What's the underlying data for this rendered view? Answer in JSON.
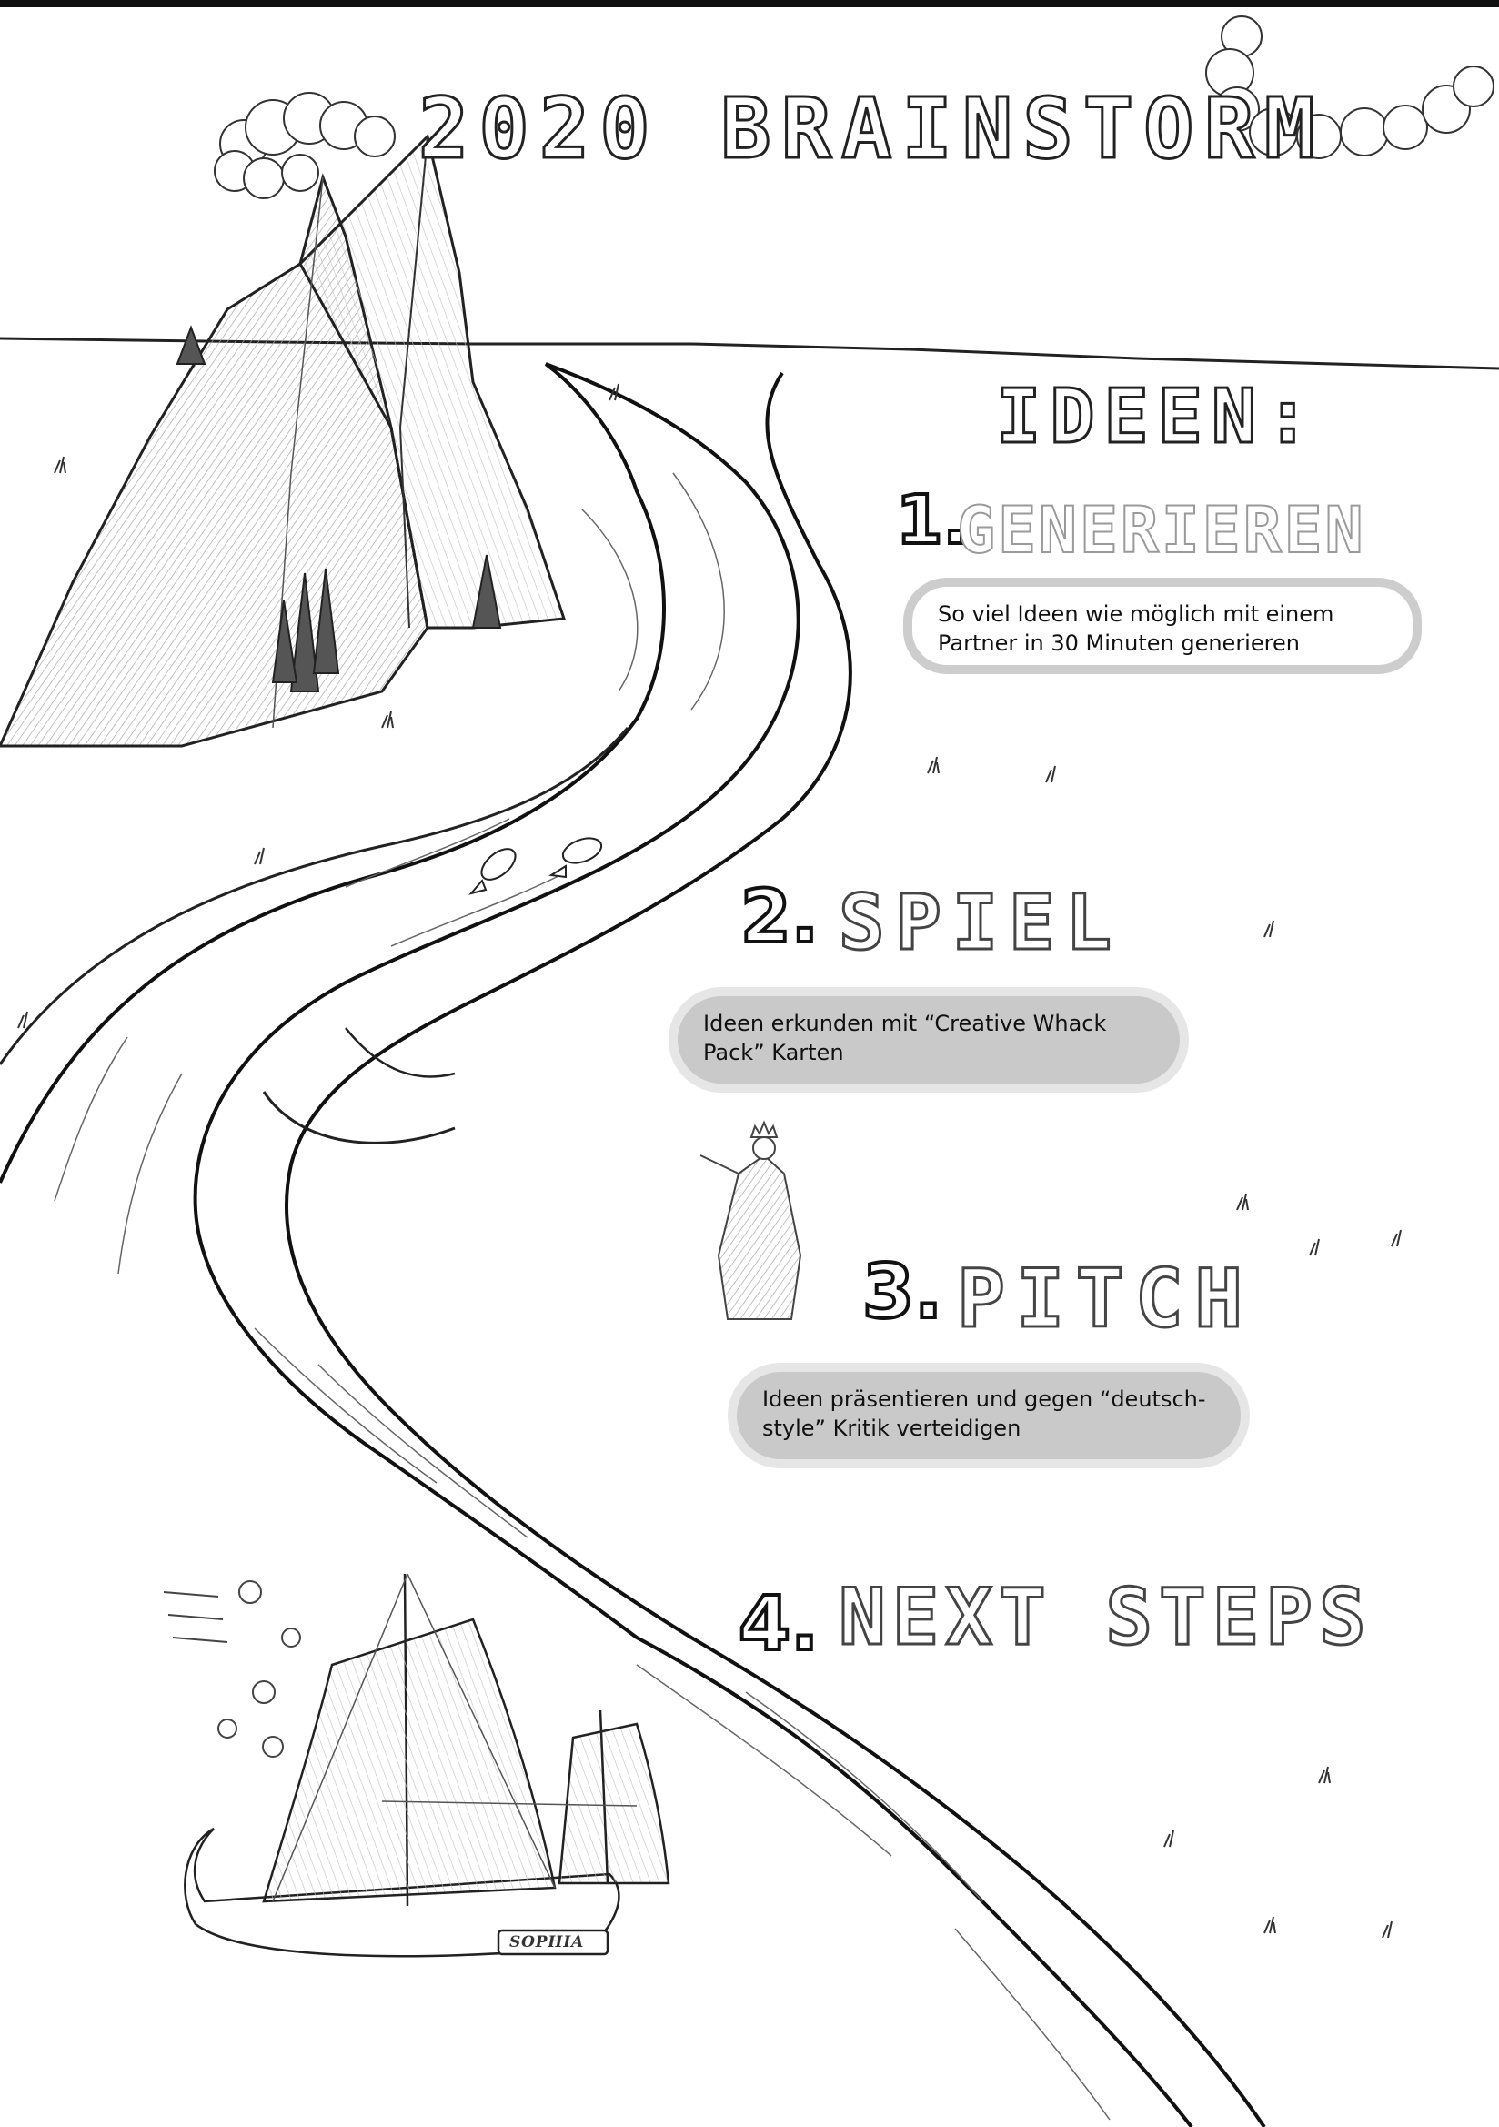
{
  "title": "2020 BRAINSTORM",
  "ideas_heading": "IDEEN:",
  "steps": [
    {
      "number": "1.",
      "title": "GENERIEREN",
      "description": "So viel Ideen wie möglich mit einem Partner in 30 Minuten generieren"
    },
    {
      "number": "2.",
      "title": "SPIEL",
      "description": "Ideen erkunden mit “Creative Whack Pack” Karten"
    },
    {
      "number": "3.",
      "title": "PITCH",
      "description": "Ideen präsentieren und gegen “deutsch-style” Kritik verteidigen"
    },
    {
      "number": "4.",
      "title": "NEXT STEPS"
    }
  ],
  "ship_name": "SOPHIA"
}
